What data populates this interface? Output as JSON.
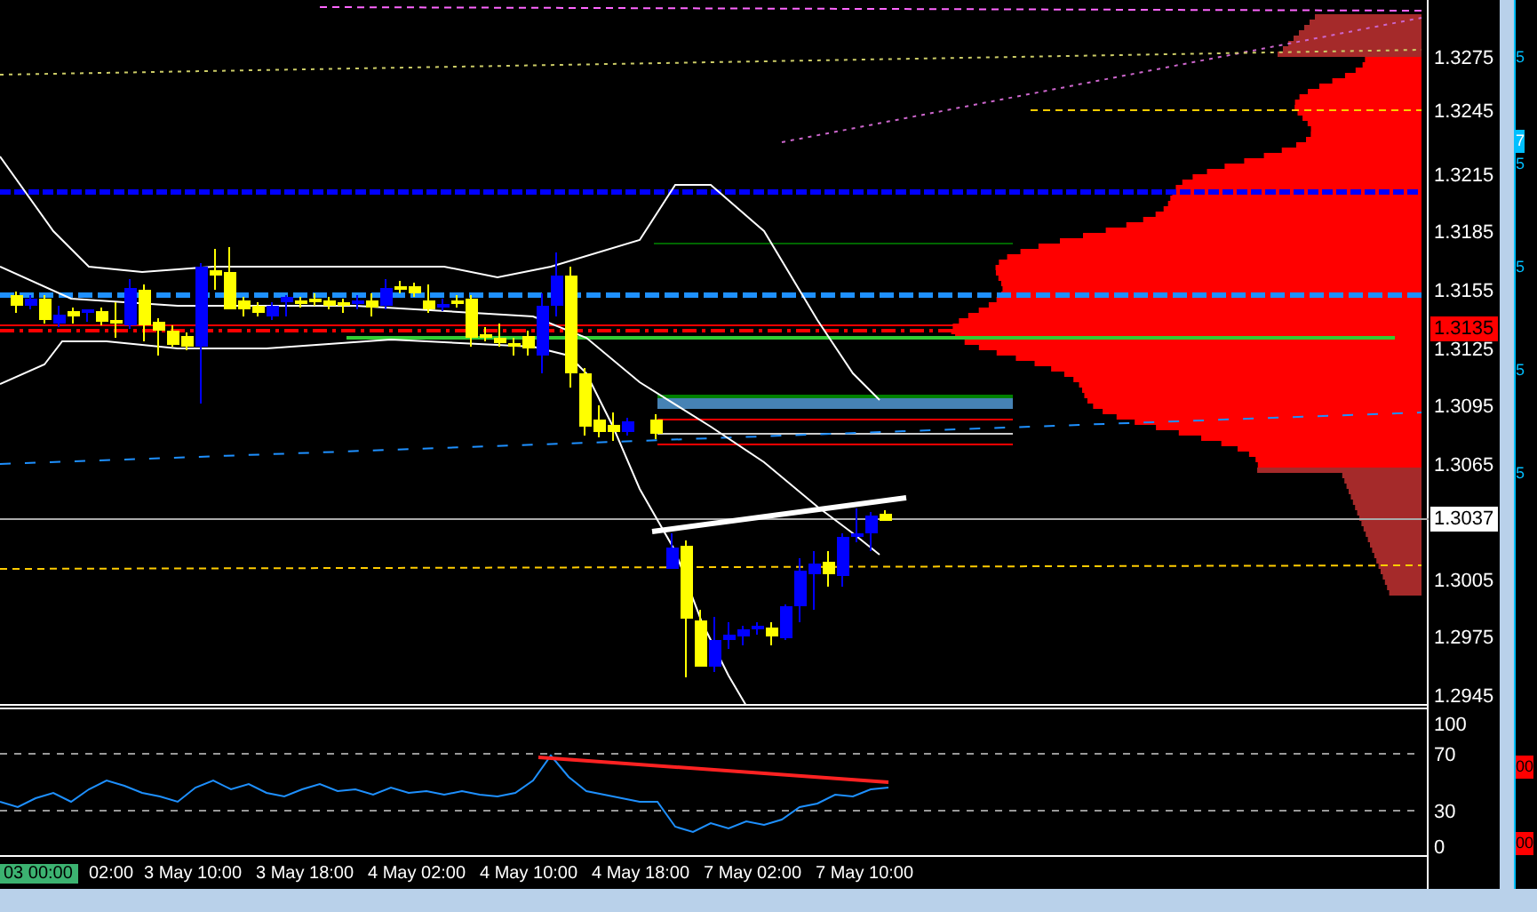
{
  "price_axis": {
    "ticks": [
      "1.3275",
      "1.3245",
      "1.3215",
      "1.3185",
      "1.3155",
      "1.3125",
      "1.3095",
      "1.3065",
      "1.3005",
      "1.2975",
      "1.2945"
    ],
    "markers": [
      {
        "kind": "line",
        "text": "1.3135"
      },
      {
        "kind": "last",
        "text": "1.3037"
      }
    ]
  },
  "indicator_axis": {
    "ticks": [
      "100",
      "70",
      "30",
      "0"
    ]
  },
  "time_axis": {
    "cursor_label": "03 00:00",
    "labels": [
      "02:00",
      "3 May 10:00",
      "3 May 18:00",
      "4 May 02:00",
      "4 May 10:00",
      "4 May 18:00",
      "7 May 02:00",
      "7 May 10:00"
    ]
  },
  "side_strip": {
    "items": [
      {
        "kind": "tick",
        "text": "5"
      },
      {
        "kind": "highlight",
        "text": "7"
      },
      {
        "kind": "tick",
        "text": "5"
      },
      {
        "kind": "tick",
        "text": "5"
      },
      {
        "kind": "tick",
        "text": "5"
      },
      {
        "kind": "tick",
        "text": "5"
      },
      {
        "kind": "alert",
        "text": "00"
      },
      {
        "kind": "alert",
        "text": "00"
      }
    ]
  }
}
